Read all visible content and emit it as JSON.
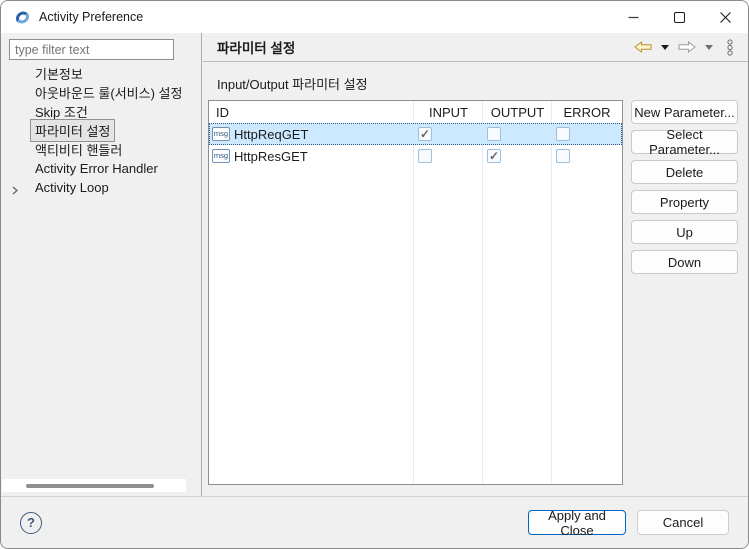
{
  "window": {
    "title": "Activity Preference",
    "icons": {
      "app": "activity-app-icon",
      "minimize": "minimize-icon",
      "maximize": "maximize-icon",
      "close": "close-icon"
    }
  },
  "sidebar": {
    "filter_placeholder": "type filter text",
    "items": [
      {
        "label": "기본정보",
        "selected": false,
        "expandable": false
      },
      {
        "label": "아웃바운드 룰(서비스) 설정",
        "selected": false,
        "expandable": false
      },
      {
        "label": "Skip 조건",
        "selected": false,
        "expandable": false
      },
      {
        "label": "파라미터 설정",
        "selected": true,
        "expandable": false
      },
      {
        "label": "액티비티 핸들러",
        "selected": false,
        "expandable": false
      },
      {
        "label": "Activity Error Handler",
        "selected": false,
        "expandable": false
      },
      {
        "label": "Activity Loop",
        "selected": false,
        "expandable": true
      }
    ]
  },
  "header": {
    "title": "파라미터 설정",
    "icons": {
      "back": "back-arrow-icon",
      "forward": "forward-arrow-icon",
      "menu": "view-menu-icon"
    }
  },
  "main": {
    "section_label": "Input/Output 파라미터 설정",
    "table": {
      "columns": [
        "ID",
        "INPUT",
        "OUTPUT",
        "ERROR"
      ],
      "rows": [
        {
          "id": "HttpReqGET",
          "icon_label": "msg",
          "input": true,
          "output": false,
          "error": false,
          "selected": true
        },
        {
          "id": "HttpResGET",
          "icon_label": "msg",
          "input": false,
          "output": true,
          "error": false,
          "selected": false
        }
      ]
    },
    "buttons": [
      "New Parameter...",
      "Select Parameter...",
      "Delete",
      "Property",
      "Up",
      "Down"
    ]
  },
  "footer": {
    "help_icon": "?",
    "apply_label": "Apply and Close",
    "cancel_label": "Cancel"
  },
  "colors": {
    "accent_blue": "#0067c0",
    "selected_row_bg": "#cde9ff",
    "back_arrow_gold": "#b8912c",
    "help_icon_blue": "#3d5a7d"
  }
}
